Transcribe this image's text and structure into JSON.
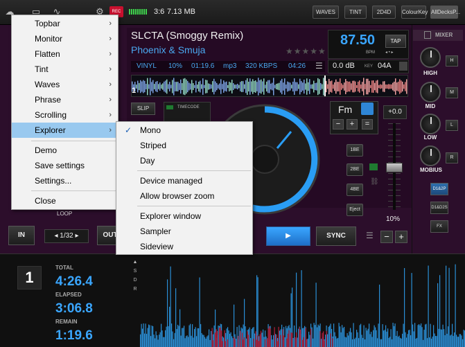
{
  "topbar": {
    "rec_label": "REC",
    "rec_time": "3:6",
    "rec_size": "7.13 MB",
    "buttons": [
      "WAVES",
      "TINT",
      "2D4D",
      "ColourKey",
      "AllDecksP..."
    ]
  },
  "deck": {
    "title": "SLCTA (Smoggy Remix)",
    "artist": "Phoenix & Smuja",
    "stars": "★★★★★",
    "bpm": "87.50",
    "bpm_label": "BPM",
    "tap_label": "TAP",
    "pitch_arrows": "◂ • ▸",
    "info": {
      "source": "VINYL",
      "pitch": "10%",
      "position": "01:19.6",
      "format": "mp3",
      "bitrate": "320 KBPS",
      "length": "04:26"
    },
    "gain": "0.0 dB",
    "key_label": "KEY",
    "key": "04A",
    "deck_number": "1",
    "slip_label": "SLIP",
    "timecode_label": "TIMECODE",
    "musical_key": "Fm",
    "key_buttons": [
      "−",
      "+",
      "="
    ],
    "loop_buttons": [
      "1BE",
      "2BE",
      "4BE",
      "Eject"
    ],
    "pitch_value": "+0.0",
    "pitch_range": "10%",
    "loop_label": "LOOP",
    "in_label": "IN",
    "loop_size": "1/32",
    "out_label": "OUT",
    "play_label": "▶",
    "sync_label": "SYNC",
    "minus_label": "−",
    "plus_label": "+"
  },
  "mixer": {
    "title": "MIXER",
    "knobs": [
      {
        "label": "HIGH",
        "button": "H"
      },
      {
        "label": "MID",
        "button": "M"
      },
      {
        "label": "LOW",
        "button": "L"
      },
      {
        "label": "MOBIUS",
        "button": "R"
      }
    ],
    "buttons": [
      "D1&2P",
      "D1&D2S",
      "FX"
    ]
  },
  "bottom": {
    "deck_number": "1",
    "total_label": "TOTAL",
    "total": "4:26.4",
    "elapsed_label": "ELAPSED",
    "elapsed": "3:06.8",
    "remain_label": "REMAIN",
    "remain": "1:19.6",
    "sdr": [
      "▲",
      "S",
      "D",
      "R"
    ]
  },
  "menu": {
    "items": [
      {
        "label": "Topbar",
        "arrow": "›"
      },
      {
        "label": "Monitor",
        "arrow": "›"
      },
      {
        "label": "Flatten",
        "arrow": "›"
      },
      {
        "label": "Tint",
        "arrow": "›"
      },
      {
        "label": "Waves",
        "arrow": "›"
      },
      {
        "label": "Phrase",
        "arrow": "›"
      },
      {
        "label": "Scrolling",
        "arrow": "›"
      },
      {
        "label": "Explorer",
        "arrow": "›"
      },
      {
        "label": "Demo"
      },
      {
        "label": "Save settings"
      },
      {
        "label": "Settings..."
      },
      {
        "label": "Close"
      }
    ]
  },
  "submenu": {
    "items": [
      {
        "label": "Mono",
        "checked": "✓"
      },
      {
        "label": "Striped"
      },
      {
        "label": "Day"
      },
      {
        "label": "Device managed"
      },
      {
        "label": "Allow browser zoom"
      },
      {
        "label": "Explorer window"
      },
      {
        "label": "Sampler"
      },
      {
        "label": "Sideview"
      }
    ]
  },
  "colors": {
    "accent_blue": "#3aa6ff",
    "deck_bg": "#2c0e2b",
    "menu_highlight": "#99c9ef"
  }
}
